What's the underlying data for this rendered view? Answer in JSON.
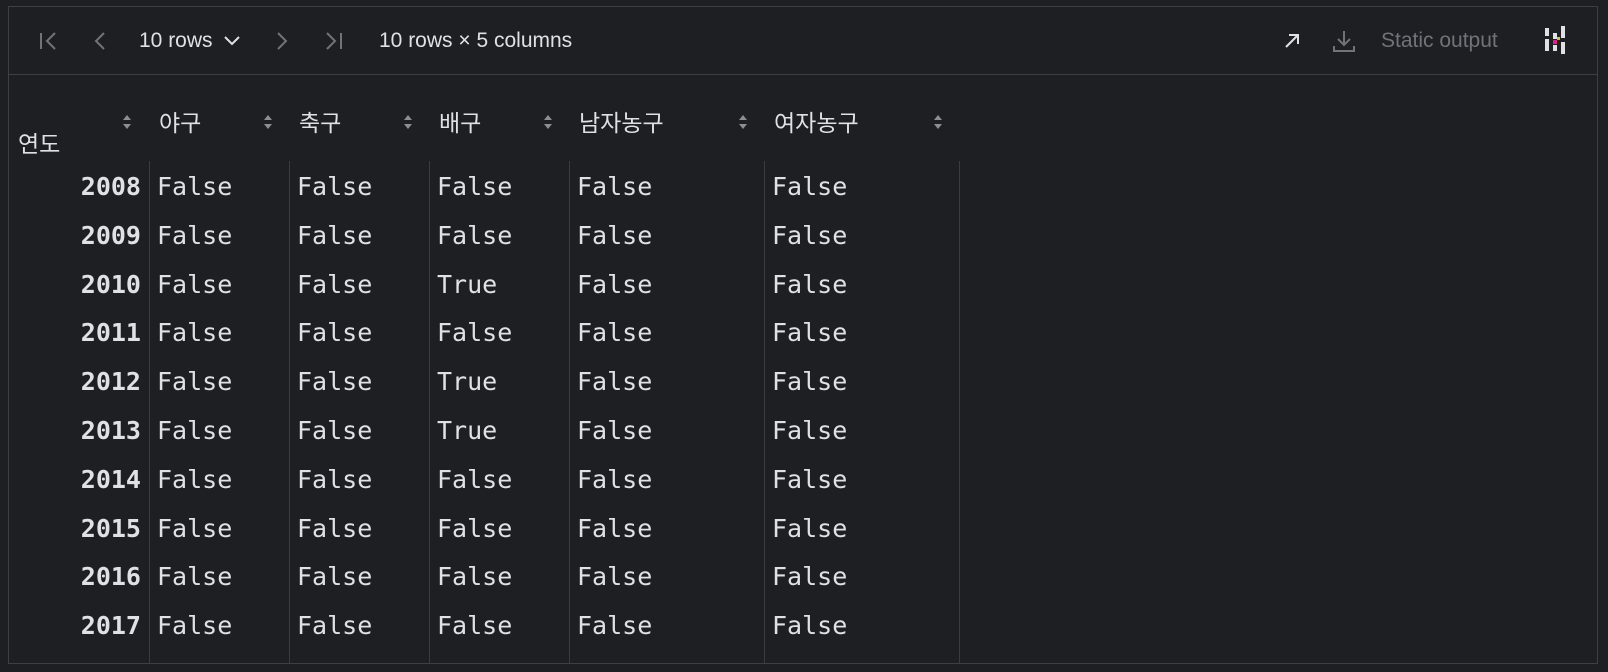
{
  "toolbar": {
    "rows_label": "10 rows",
    "shape_label": "10 rows × 5 columns",
    "static_output": "Static output",
    "icons": [
      "first-page-icon",
      "prev-page-icon",
      "chevron-down-icon",
      "next-page-icon",
      "last-page-icon",
      "open-external-icon",
      "download-icon",
      "pandas-logo-icon"
    ]
  },
  "table": {
    "index_name": "연도",
    "columns": [
      "야구",
      "축구",
      "배구",
      "남자농구",
      "여자농구"
    ],
    "rows": [
      {
        "index": "2008",
        "cells": [
          "False",
          "False",
          "False",
          "False",
          "False"
        ]
      },
      {
        "index": "2009",
        "cells": [
          "False",
          "False",
          "False",
          "False",
          "False"
        ]
      },
      {
        "index": "2010",
        "cells": [
          "False",
          "False",
          "True",
          "False",
          "False"
        ]
      },
      {
        "index": "2011",
        "cells": [
          "False",
          "False",
          "False",
          "False",
          "False"
        ]
      },
      {
        "index": "2012",
        "cells": [
          "False",
          "False",
          "True",
          "False",
          "False"
        ]
      },
      {
        "index": "2013",
        "cells": [
          "False",
          "False",
          "True",
          "False",
          "False"
        ]
      },
      {
        "index": "2014",
        "cells": [
          "False",
          "False",
          "False",
          "False",
          "False"
        ]
      },
      {
        "index": "2015",
        "cells": [
          "False",
          "False",
          "False",
          "False",
          "False"
        ]
      },
      {
        "index": "2016",
        "cells": [
          "False",
          "False",
          "False",
          "False",
          "False"
        ]
      },
      {
        "index": "2017",
        "cells": [
          "False",
          "False",
          "False",
          "False",
          "False"
        ]
      }
    ]
  },
  "colors": {
    "background": "#1e1f22",
    "border": "#3d3f44",
    "text": "#dfe1e5",
    "muted": "#6f737a"
  }
}
